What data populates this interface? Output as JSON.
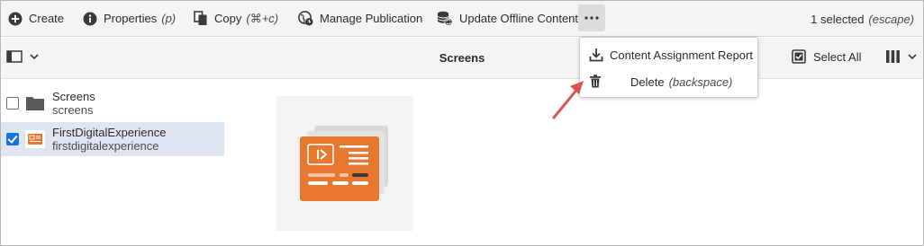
{
  "toolbar": {
    "create_label": "Create",
    "properties_label": "Properties",
    "properties_shortcut": "(p)",
    "copy_label": "Copy",
    "copy_shortcut": "(⌘+c)",
    "manage_publication_label": "Manage Publication",
    "update_offline_label": "Update Offline Content",
    "more_label": "•••",
    "selected_text": "1 selected",
    "escape_hint": "(escape)"
  },
  "viewbar": {
    "title": "Screens",
    "select_all_label": "Select All"
  },
  "tree": {
    "items": [
      {
        "title": "Screens",
        "subtitle": "screens",
        "checked": false,
        "icon": "folder-icon"
      },
      {
        "title": "FirstDigitalExperience",
        "subtitle": "firstdigitalexperience",
        "checked": true,
        "icon": "experience-thumb-icon"
      }
    ]
  },
  "menu": {
    "items": [
      {
        "label": "Content Assignment Report",
        "shortcut": "",
        "icon": "download-icon"
      },
      {
        "label": "Delete",
        "shortcut": "(backspace)",
        "icon": "trash-icon"
      }
    ]
  },
  "colors": {
    "accent_blue": "#1473e6",
    "selection_bg": "#dfe6f2",
    "thumb_orange": "#e8782f",
    "annotation_arrow": "#d9534f"
  }
}
